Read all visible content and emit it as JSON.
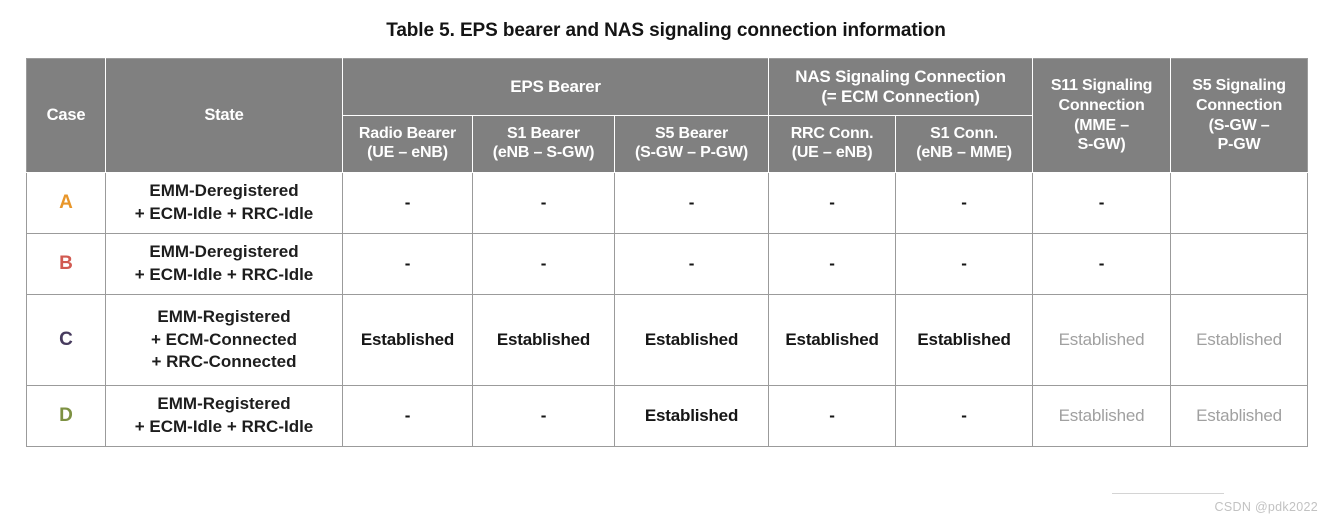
{
  "title": "Table 5. EPS bearer and NAS signaling connection information",
  "header": {
    "case": "Case",
    "state": "State",
    "eps_bearer_group": "EPS Bearer",
    "nas_group_line1": "NAS Signaling Connection",
    "nas_group_line2": "(= ECM Connection)",
    "radio_bearer_line1": "Radio Bearer",
    "radio_bearer_line2": "(UE – eNB)",
    "s1_bearer_line1": "S1 Bearer",
    "s1_bearer_line2": "(eNB – S-GW)",
    "s5_bearer_line1": "S5 Bearer",
    "s5_bearer_line2": "(S-GW – P-GW)",
    "rrc_conn_line1": "RRC Conn.",
    "rrc_conn_line2": "(UE – eNB)",
    "s1_conn_line1": "S1 Conn.",
    "s1_conn_line2": "(eNB – MME)",
    "s11_line1": "S11 Signaling",
    "s11_line2": "Connection",
    "s11_line3": "(MME –",
    "s11_line4": "S-GW)",
    "s5sig_line1": "S5 Signaling",
    "s5sig_line2": "Connection",
    "s5sig_line3": "(S-GW –",
    "s5sig_line4": "P-GW"
  },
  "rows": [
    {
      "case": "A",
      "case_color": "#E8962A",
      "state_lines": [
        "EMM-Deregistered",
        "+ ECM-Idle + RRC-Idle"
      ],
      "radio_bearer": "-",
      "s1_bearer": "-",
      "s5_bearer": "-",
      "rrc_conn": "-",
      "s1_conn": "-",
      "s11_signaling": "-",
      "s5_signaling": "",
      "s11_muted": false,
      "s5sig_muted": false
    },
    {
      "case": "B",
      "case_color": "#D15A51",
      "state_lines": [
        "EMM-Deregistered",
        "+ ECM-Idle + RRC-Idle"
      ],
      "radio_bearer": "-",
      "s1_bearer": "-",
      "s5_bearer": "-",
      "rrc_conn": "-",
      "s1_conn": "-",
      "s11_signaling": "-",
      "s5_signaling": "",
      "s11_muted": false,
      "s5sig_muted": false
    },
    {
      "case": "C",
      "case_color": "#473B5E",
      "state_lines": [
        "EMM-Registered",
        "+ ECM-Connected",
        "+ RRC-Connected"
      ],
      "radio_bearer": "Established",
      "s1_bearer": "Established",
      "s5_bearer": "Established",
      "rrc_conn": "Established",
      "s1_conn": "Established",
      "s11_signaling": "Established",
      "s5_signaling": "Established",
      "s11_muted": true,
      "s5sig_muted": true
    },
    {
      "case": "D",
      "case_color": "#7D9142",
      "state_lines": [
        "EMM-Registered",
        "+ ECM-Idle + RRC-Idle"
      ],
      "radio_bearer": "-",
      "s1_bearer": "-",
      "s5_bearer": "Established",
      "rrc_conn": "-",
      "s1_conn": "-",
      "s11_signaling": "Established",
      "s5_signaling": "Established",
      "s11_muted": true,
      "s5sig_muted": true
    }
  ],
  "watermark": "CSDN @pdk2022",
  "colors": {
    "header_bg": "#808080",
    "header_text": "#ffffff",
    "grid_line": "#9b9b9b",
    "muted_text": "#a0a0a0"
  }
}
